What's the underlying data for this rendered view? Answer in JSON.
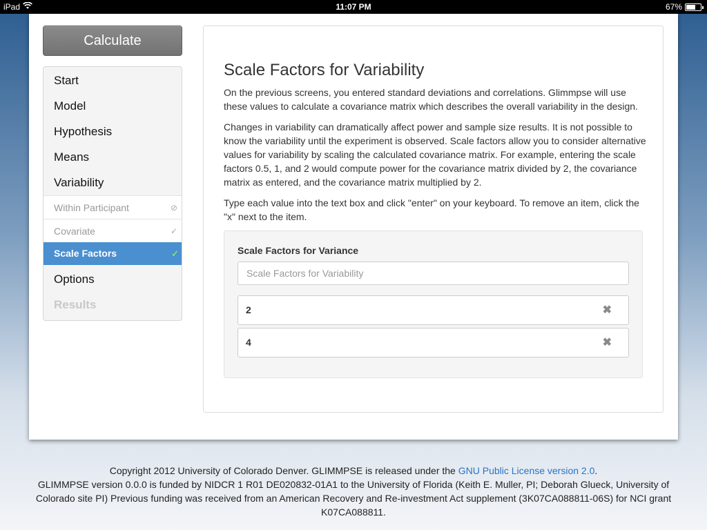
{
  "status_bar": {
    "device": "iPad",
    "time": "11:07 PM",
    "battery": "67%",
    "battery_level": 0.67
  },
  "sidebar": {
    "calculate_label": "Calculate",
    "items": [
      {
        "label": "Start"
      },
      {
        "label": "Model"
      },
      {
        "label": "Hypothesis"
      },
      {
        "label": "Means"
      },
      {
        "label": "Variability"
      }
    ],
    "sub_items": [
      {
        "label": "Within Participant",
        "status_icon": "⊘"
      },
      {
        "label": "Covariate",
        "status_icon": "✓"
      },
      {
        "label": "Scale Factors",
        "status_icon": "✓"
      }
    ],
    "options_label": "Options",
    "results_label": "Results"
  },
  "main": {
    "title": "Scale Factors for Variability",
    "paragraph_1": "On the previous screens, you entered standard deviations and correlations. Glimmpse will use these values to calculate a covariance matrix which describes the overall variability in the design.",
    "paragraph_2": "Changes in variability can dramatically affect power and sample size results. It is not possible to know the variability until the experiment is observed. Scale factors allow you to consider alternative values for variability by scaling the calculated covariance matrix. For example, entering the scale factors 0.5, 1, and 2 would compute power for the covariance matrix divided by 2, the covariance matrix as entered, and the covariance matrix multiplied by 2.",
    "paragraph_3": "Type each value into the text box and click \"enter\" on your keyboard. To remove an item, click the \"x\" next to the item.",
    "well_title": "Scale Factors for Variance",
    "input_placeholder": "Scale Factors for Variability",
    "values": [
      "2",
      "4"
    ],
    "remove_icon": "✖"
  },
  "footer": {
    "line1_prefix": "Copyright 2012 University of Colorado Denver. GLIMMPSE is released under the ",
    "license_link": "GNU Public License version 2.0",
    "line1_suffix": ".",
    "line2": "GLIMMPSE version 0.0.0 is funded by NIDCR 1 R01 DE020832-01A1 to the University of Florida (Keith E. Muller, PI; Deborah Glueck, University of Colorado site PI) Previous funding was received from an American Recovery and Re-investment Act supplement (3K07CA088811-06S) for NCI grant K07CA088811."
  },
  "colors": {
    "accent": "#4a8fd0",
    "link": "#2a73c4",
    "calculate_button": "#7a7a7a"
  }
}
